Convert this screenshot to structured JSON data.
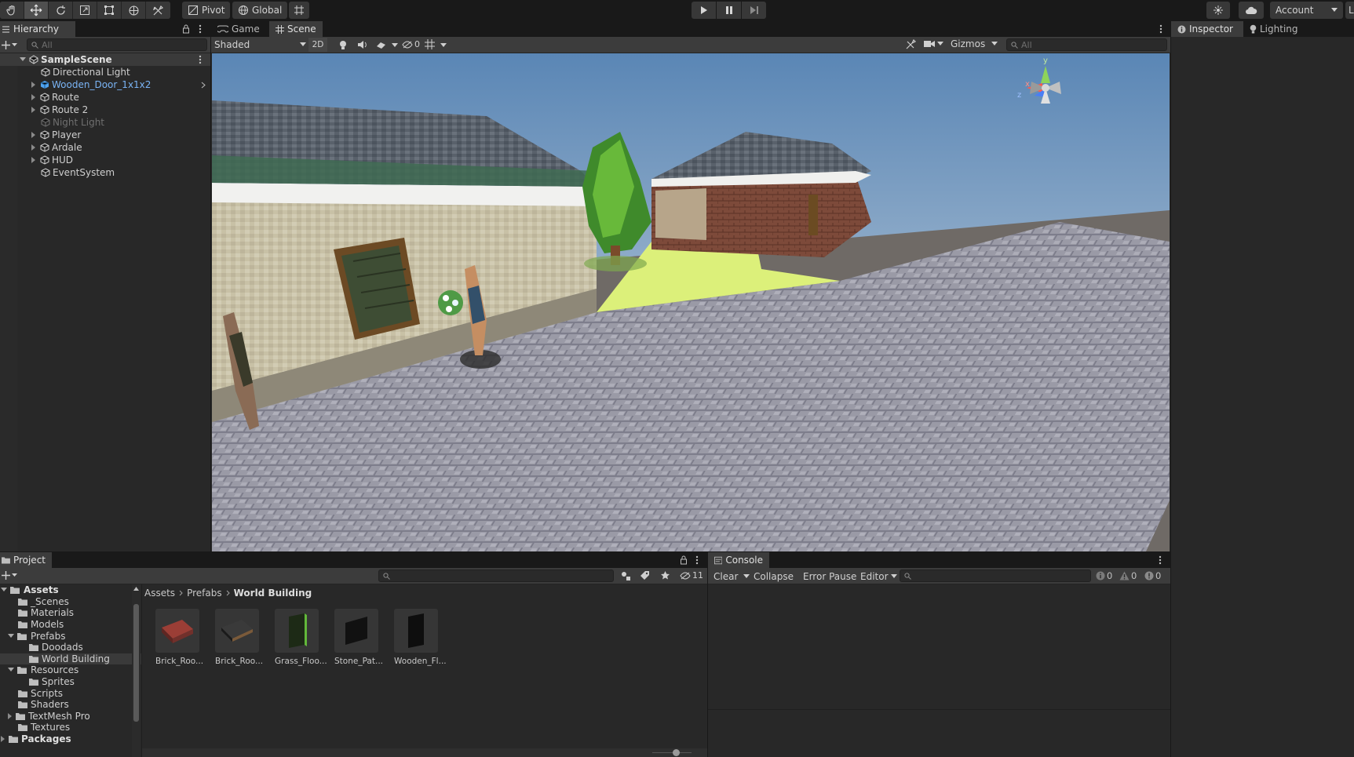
{
  "toolbar": {
    "tools": [
      "hand-tool-icon",
      "move-tool-icon",
      "rotate-tool-icon",
      "scale-tool-icon",
      "rect-tool-icon",
      "transform-tool-icon",
      "custom-tool-icon"
    ],
    "pivot_label": "Pivot",
    "global_label": "Global",
    "account_label": "Account",
    "layers_label": "La"
  },
  "hierarchy": {
    "tab_label": "Hierarchy",
    "search_placeholder": "All",
    "scene_name": "SampleScene",
    "items": [
      {
        "label": "Directional Light"
      },
      {
        "label": "Wooden_Door_1x1x2"
      },
      {
        "label": "Route"
      },
      {
        "label": "Route 2"
      },
      {
        "label": "Night Light"
      },
      {
        "label": "Player"
      },
      {
        "label": "Ardale"
      },
      {
        "label": "HUD"
      },
      {
        "label": "EventSystem"
      }
    ]
  },
  "scene": {
    "tabs": [
      {
        "label": "Game"
      },
      {
        "label": "Scene"
      }
    ],
    "shading_mode": "Shaded",
    "mode_2d": "2D",
    "hidden_count": "0",
    "gizmos_label": "Gizmos",
    "search_placeholder": "All",
    "axis_x": "x",
    "axis_y": "y",
    "axis_z": "z"
  },
  "right_panel": {
    "tabs": [
      {
        "label": "Inspector"
      },
      {
        "label": "Lighting"
      }
    ]
  },
  "project": {
    "tab_label": "Project",
    "hidden_count": "11",
    "breadcrumb": [
      "Assets",
      "Prefabs",
      "World Building"
    ],
    "tree": [
      {
        "label": "Assets"
      },
      {
        "label": "_Scenes"
      },
      {
        "label": "Materials"
      },
      {
        "label": "Models"
      },
      {
        "label": "Prefabs"
      },
      {
        "label": "Doodads"
      },
      {
        "label": "World Building"
      },
      {
        "label": "Resources"
      },
      {
        "label": "Sprites"
      },
      {
        "label": "Scripts"
      },
      {
        "label": "Shaders"
      },
      {
        "label": "TextMesh Pro"
      },
      {
        "label": "Textures"
      },
      {
        "label": "Packages"
      }
    ],
    "assets": [
      {
        "label": "Brick_Roo...",
        "color": "#8a3b35"
      },
      {
        "label": "Brick_Roo...",
        "color": "#2f2f2f"
      },
      {
        "label": "Grass_Floo...",
        "color": "#1e2a18"
      },
      {
        "label": "Stone_Pat...",
        "color": "#121212"
      },
      {
        "label": "Wooden_Fl...",
        "color": "#111111"
      }
    ]
  },
  "console": {
    "tab_label": "Console",
    "clear_label": "Clear",
    "collapse_label": "Collapse",
    "error_pause_label": "Error Pause",
    "editor_label": "Editor",
    "log_count": "0",
    "warning_count": "0",
    "error_count": "0"
  }
}
